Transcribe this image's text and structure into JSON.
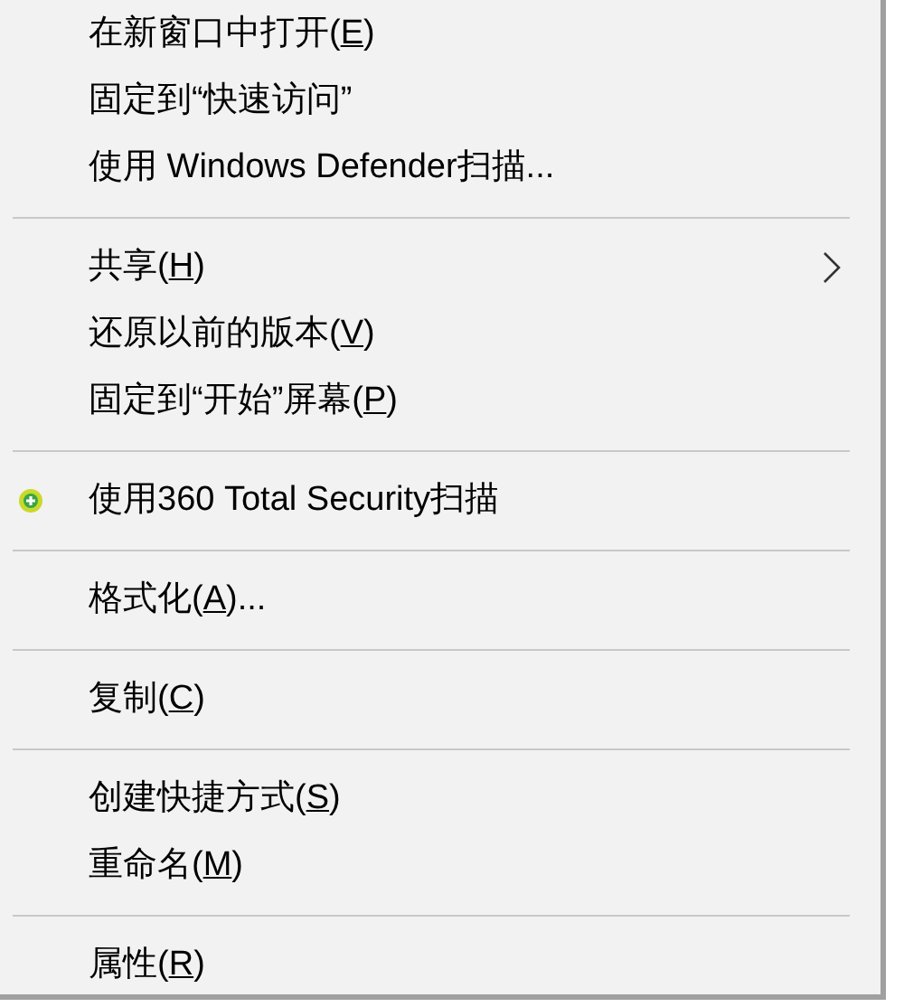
{
  "menu": [
    {
      "kind": "item",
      "label": {
        "pre": "在新窗口中打开(",
        "key": "E",
        "post": ")"
      },
      "has_icon": false,
      "submenu": false
    },
    {
      "kind": "item",
      "label": {
        "pre": "固定到“快速访问”"
      },
      "has_icon": false,
      "submenu": false
    },
    {
      "kind": "item",
      "label": {
        "pre": "使用 Windows Defender扫描..."
      },
      "has_icon": false,
      "submenu": false
    },
    {
      "kind": "separator"
    },
    {
      "kind": "item",
      "label": {
        "pre": "共享(",
        "key": "H",
        "post": ")"
      },
      "has_icon": false,
      "submenu": true
    },
    {
      "kind": "item",
      "label": {
        "pre": "还原以前的版本(",
        "key": "V",
        "post": ")"
      },
      "has_icon": false,
      "submenu": false
    },
    {
      "kind": "item",
      "label": {
        "pre": "固定到“开始”屏幕(",
        "key": "P",
        "post": ")"
      },
      "has_icon": false,
      "submenu": false
    },
    {
      "kind": "separator"
    },
    {
      "kind": "item",
      "label": {
        "pre": "使用360 Total Security扫描"
      },
      "has_icon": true,
      "submenu": false
    },
    {
      "kind": "separator"
    },
    {
      "kind": "item",
      "label": {
        "pre": "格式化(",
        "key": "A",
        "post": ")..."
      },
      "has_icon": false,
      "submenu": false
    },
    {
      "kind": "separator"
    },
    {
      "kind": "item",
      "label": {
        "pre": "复制(",
        "key": "C",
        "post": ")"
      },
      "has_icon": false,
      "submenu": false
    },
    {
      "kind": "separator"
    },
    {
      "kind": "item",
      "label": {
        "pre": "创建快捷方式(",
        "key": "S",
        "post": ")"
      },
      "has_icon": false,
      "submenu": false
    },
    {
      "kind": "item",
      "label": {
        "pre": "重命名(",
        "key": "M",
        "post": ")"
      },
      "has_icon": false,
      "submenu": false
    },
    {
      "kind": "separator"
    },
    {
      "kind": "item",
      "label": {
        "pre": "属性(",
        "key": "R",
        "post": ")"
      },
      "has_icon": false,
      "submenu": false
    }
  ]
}
